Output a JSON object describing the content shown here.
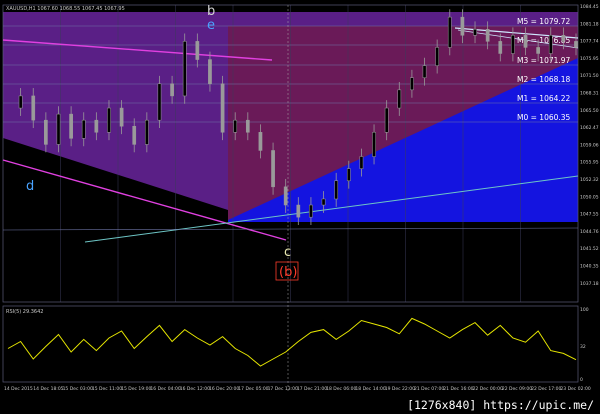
{
  "colors": {
    "bg": "#000000",
    "purple": "#5a1f86",
    "maroon": "#6a1a58",
    "blue": "#1414e0",
    "grid": "#3a3a5a",
    "candle": "#9a9a9a",
    "rsi": "#e6e600",
    "magenta": "#e040e0",
    "level": "#6f76a8"
  },
  "header": {
    "symbol_info": "XAUUSD,H1  1067.60 1068.55 1067.45 1067.95"
  },
  "rsi_panel": {
    "label": "RSI(5) 29.3642",
    "ticks": [
      "100",
      "32",
      "0"
    ]
  },
  "waves": [
    {
      "label": "b",
      "color": "#d3d3d3"
    },
    {
      "label": "e",
      "color": "#4aa3ff"
    },
    {
      "label": "d",
      "color": "#4aa3ff"
    },
    {
      "label": "c",
      "color": "#e8e8b0"
    },
    {
      "label": "(b)",
      "color": "#ff3b2b"
    }
  ],
  "levels": [
    {
      "label": "M5 = 1079.72",
      "color": "#ffffff"
    },
    {
      "label": "M4 = 1076.85",
      "color": "#ffffff"
    },
    {
      "label": "M3 = 1071.97",
      "color": "#ffffff"
    },
    {
      "label": "M2 = 1068.18",
      "color": "#ffffff"
    },
    {
      "label": "M1 = 1064.22",
      "color": "#ffffff"
    },
    {
      "label": "M0 = 1060.35",
      "color": "#ffffff"
    }
  ],
  "price_ticks": [
    "1084.45",
    "1081.18",
    "1077.74",
    "1075.95",
    "1071.50",
    "1068.31",
    "1065.50",
    "1062.47",
    "1059.06",
    "1055.95",
    "1052.32",
    "1050.05",
    "1047.55",
    "1044.76",
    "1041.52",
    "1040.35",
    "1037.18"
  ],
  "time_ticks": [
    "14 Dec 2015",
    "14 Dec 18:05",
    "15 Dec 03:00",
    "15 Dec 11:00",
    "15 Dec 19:00",
    "16 Dec 04:00",
    "16 Dec 12:00",
    "16 Dec 20:00",
    "17 Dec 05:00",
    "17 Dec 13:00",
    "17 Dec 21:00",
    "18 Dec 06:00",
    "18 Dec 14:00",
    "19 Dec 22:00",
    "21 Dec 07:00",
    "21 Dec 16:00",
    "22 Dec 00:00",
    "22 Dec 09:00",
    "22 Dec 17:00",
    "23 Dec 02:00"
  ],
  "watermark": "[1276x840] https://upic.me/",
  "chart_data": {
    "type": "line",
    "title": "",
    "x": [
      0,
      3,
      6,
      9,
      12,
      15,
      18,
      21,
      24,
      27,
      30,
      33,
      36,
      39,
      42,
      45,
      48,
      51,
      54,
      57,
      60,
      63,
      66,
      69,
      72,
      75,
      78,
      81,
      84,
      87,
      90,
      93,
      96,
      99,
      102,
      105,
      108,
      111,
      114,
      117,
      120,
      123,
      126,
      129,
      132,
      135
    ],
    "series": [
      {
        "name": "",
        "values": [
          1068,
          1070,
          1066,
          1062,
          1067,
          1063,
          1066,
          1064,
          1068,
          1065,
          1062,
          1066,
          1072,
          1070,
          1079,
          1076,
          1072,
          1064,
          1066,
          1064,
          1061,
          1055,
          1052,
          1050,
          1052,
          1053,
          1056,
          1058,
          1060,
          1064,
          1068,
          1071,
          1073,
          1075,
          1078,
          1083,
          1080,
          1081,
          1079,
          1077,
          1080,
          1078,
          1077,
          1080,
          1079,
          1078
        ]
      },
      {
        "name": "",
        "values": [
          45,
          55,
          30,
          48,
          65,
          40,
          58,
          42,
          60,
          70,
          45,
          62,
          78,
          55,
          72,
          60,
          50,
          62,
          45,
          35,
          20,
          30,
          40,
          55,
          68,
          72,
          58,
          70,
          85,
          80,
          75,
          66,
          88,
          80,
          70,
          60,
          72,
          82,
          64,
          78,
          60,
          54,
          70,
          42,
          38,
          29
        ]
      }
    ],
    "ylim": [
      1036,
      1085
    ]
  }
}
